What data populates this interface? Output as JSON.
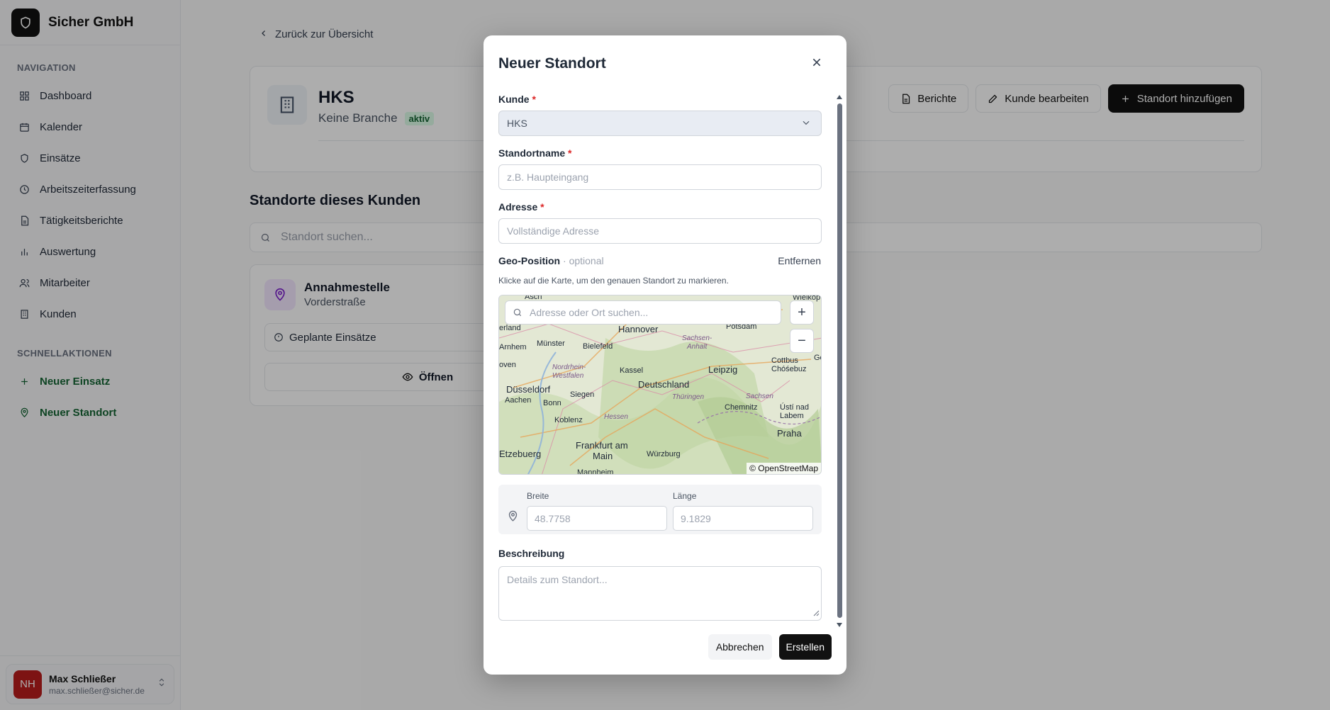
{
  "sidebar": {
    "brand": "Sicher GmbH",
    "nav_heading": "NAVIGATION",
    "nav_items": [
      {
        "label": "Dashboard",
        "icon": "grid-icon"
      },
      {
        "label": "Kalender",
        "icon": "calendar-icon"
      },
      {
        "label": "Einsätze",
        "icon": "shield-icon"
      },
      {
        "label": "Arbeitszeiterfassung",
        "icon": "clock-icon"
      },
      {
        "label": "Tätigkeitsberichte",
        "icon": "file-text-icon"
      },
      {
        "label": "Auswertung",
        "icon": "bar-chart-icon"
      },
      {
        "label": "Mitarbeiter",
        "icon": "users-icon"
      },
      {
        "label": "Kunden",
        "icon": "building-icon"
      }
    ],
    "quick_heading": "SCHNELLAKTIONEN",
    "quick_items": [
      {
        "label": "Neuer Einsatz",
        "icon": "plus-icon"
      },
      {
        "label": "Neuer Standort",
        "icon": "map-pin-icon"
      }
    ],
    "user": {
      "initials": "NH",
      "name": "Max Schließer",
      "email": "max.schließer@sicher.de"
    }
  },
  "main": {
    "back_label": "Zurück zur Übersicht",
    "customer": {
      "name": "HKS",
      "branch": "Keine Branche",
      "status": "aktiv",
      "actions": {
        "reports": "Berichte",
        "edit": "Kunde bearbeiten",
        "add_location": "Standort hinzufügen"
      }
    },
    "locations_title": "Standorte dieses Kunden",
    "search_placeholder": "Standort suchen...",
    "location": {
      "name": "Annahmestelle",
      "street": "Vorderstraße",
      "planned": "Geplante Einsätze",
      "open": "Öffnen"
    }
  },
  "modal": {
    "title": "Neuer Standort",
    "kunde_label": "Kunde",
    "kunde_value": "HKS",
    "standortname_label": "Standortname",
    "standortname_placeholder": "z.B. Haupteingang",
    "adresse_label": "Adresse",
    "adresse_placeholder": "Vollständige Adresse",
    "geo_label": "Geo-Position",
    "geo_optional": "· optional",
    "geo_remove": "Entfernen",
    "geo_hint": "Klicke auf die Karte, um den genauen Standort zu markieren.",
    "map": {
      "search_placeholder": "Adresse oder Ort suchen...",
      "zoom_in": "+",
      "zoom_out": "−",
      "attribution": "© OpenStreetMap",
      "labels": [
        "Hannover",
        "Münster",
        "Bielefeld",
        "Potsdam",
        "Wielkop",
        "Arnhem",
        "Sachsen-",
        "Anhalt",
        "Nordrhein-",
        "Westfalen",
        "Kassel",
        "Leipzig",
        "Cottbus",
        "Chóśebuz",
        "Düsseldorf",
        "Deutschland",
        "Aachen",
        "Siegen",
        "Bonn",
        "Thüringen",
        "Sachsen",
        "Chemnitz",
        "Ústí nad",
        "Labem",
        "Koblenz",
        "Hessen",
        "Frankfurt am",
        "Main",
        "Würzburg",
        "Praha",
        "Etzebuerg",
        "Asch",
        "erland",
        "oven",
        "Mannheim",
        "Ge"
      ]
    },
    "breite_label": "Breite",
    "breite_placeholder": "48.7758",
    "laenge_label": "Länge",
    "laenge_placeholder": "9.1829",
    "beschreibung_label": "Beschreibung",
    "beschreibung_placeholder": "Details zum Standort...",
    "cancel": "Abbrechen",
    "create": "Erstellen"
  }
}
